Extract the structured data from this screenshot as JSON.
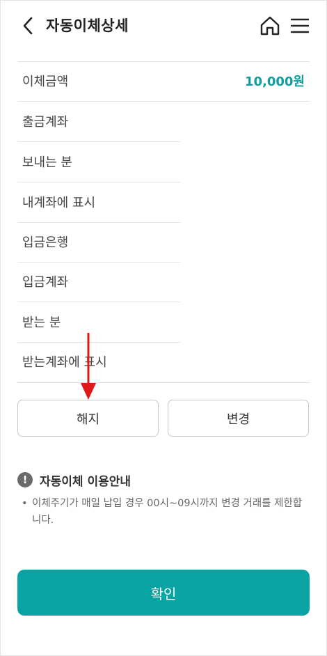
{
  "header": {
    "title": "자동이체상세",
    "back_icon": "chevron-left-icon",
    "home_icon": "home-icon",
    "menu_icon": "hamburger-menu-icon"
  },
  "details": [
    {
      "label": "이체금액",
      "value": "10,000원"
    },
    {
      "label": "출금계좌",
      "value": ""
    },
    {
      "label": "보내는 분",
      "value": ""
    },
    {
      "label": "내계좌에 표시",
      "value": ""
    },
    {
      "label": "입금은행",
      "value": ""
    },
    {
      "label": "입금계좌",
      "value": ""
    },
    {
      "label": "받는 분",
      "value": ""
    },
    {
      "label": "받는계좌에 표시",
      "value": ""
    }
  ],
  "actions": {
    "cancel_label": "해지",
    "change_label": "변경"
  },
  "notice": {
    "icon": "exclamation-circle-icon",
    "title": "자동이체 이용안내",
    "bullet": "•",
    "items": [
      "이체주기가 매일 납입 경우 00시~09시까지 변경 거래를 제한합니다."
    ]
  },
  "confirm_label": "확인",
  "colors": {
    "accent": "#0aa3a3",
    "amount": "#109e9e",
    "annotation_arrow": "#e01818"
  }
}
